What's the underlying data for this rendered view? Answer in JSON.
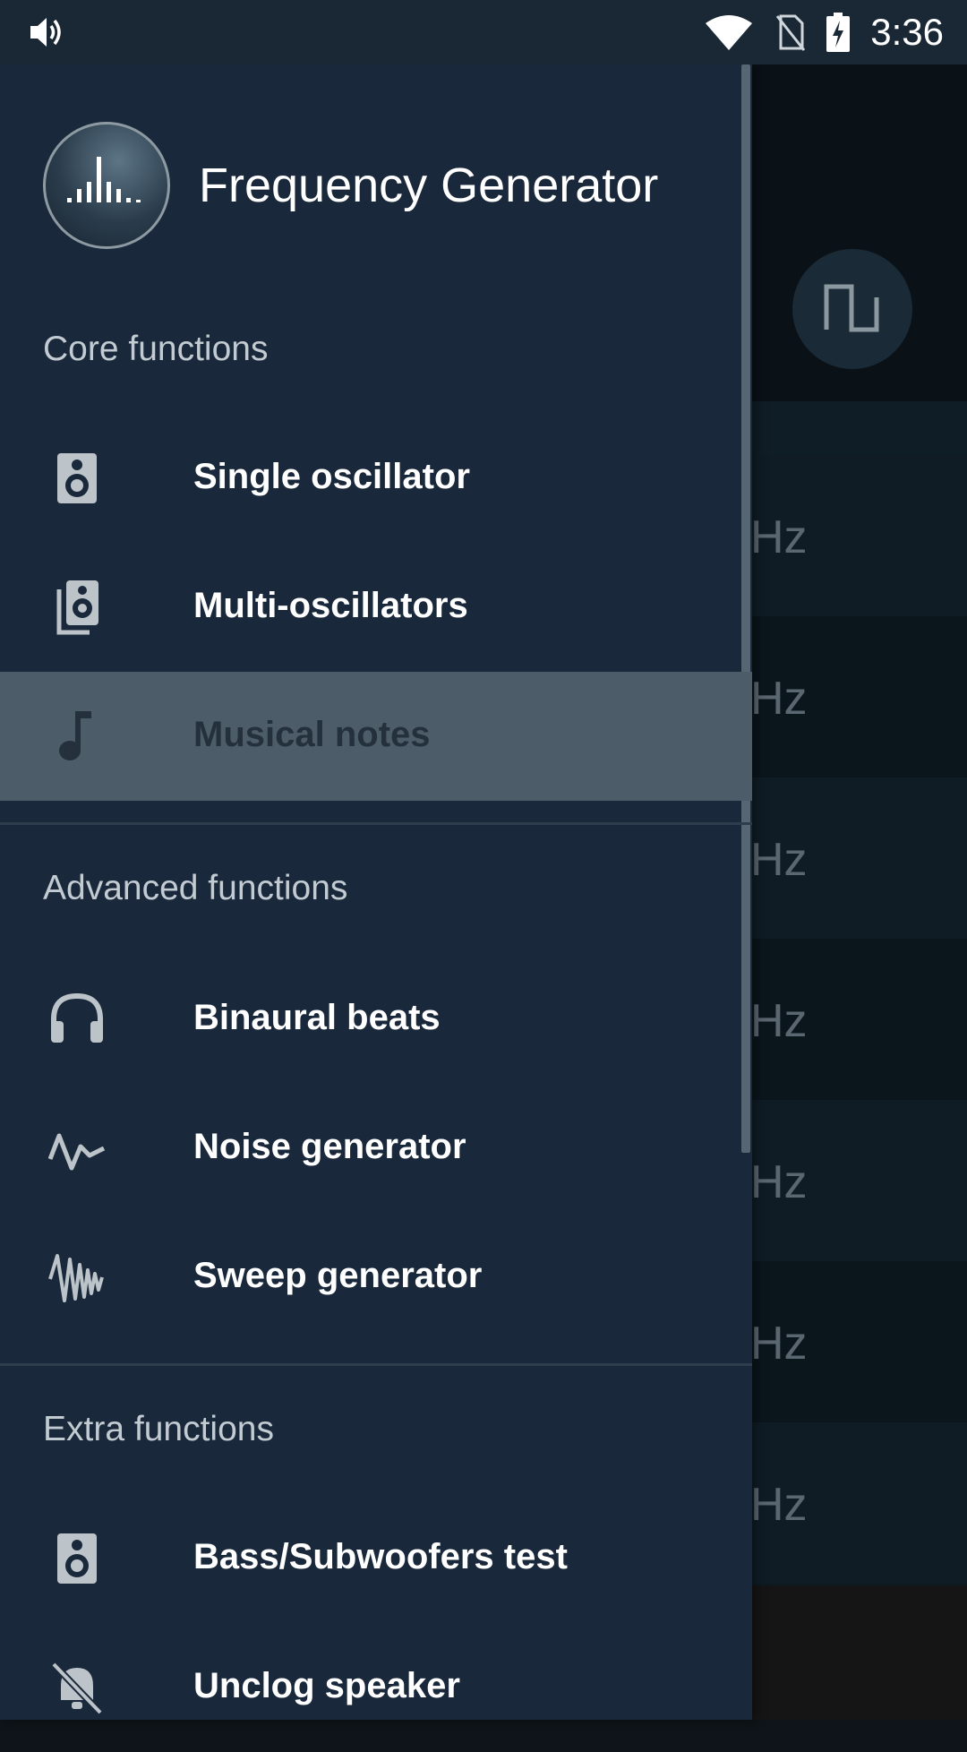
{
  "status_bar": {
    "time": "3:36"
  },
  "drawer": {
    "app_title": "Frequency Generator",
    "sections": [
      {
        "label": "Core functions"
      },
      {
        "label": "Advanced functions"
      },
      {
        "label": "Extra functions"
      }
    ],
    "items": [
      {
        "label": "Single oscillator",
        "icon": "speaker-icon"
      },
      {
        "label": "Multi-oscillators",
        "icon": "multi-speaker-icon"
      },
      {
        "label": "Musical notes",
        "icon": "music-note-icon",
        "selected": true
      },
      {
        "label": "Binaural beats",
        "icon": "headphones-icon"
      },
      {
        "label": "Noise generator",
        "icon": "noise-wave-icon"
      },
      {
        "label": "Sweep generator",
        "icon": "sweep-wave-icon"
      },
      {
        "label": "Bass/Subwoofers test",
        "icon": "speaker-icon"
      },
      {
        "label": "Unclog speaker",
        "icon": "speaker-off-icon"
      }
    ]
  },
  "background": {
    "unit_label": "Hz"
  },
  "colors": {
    "drawer_bg": "#19283a",
    "selected_bg": "#4c5c68",
    "status_bar_bg": "#1a2836"
  }
}
